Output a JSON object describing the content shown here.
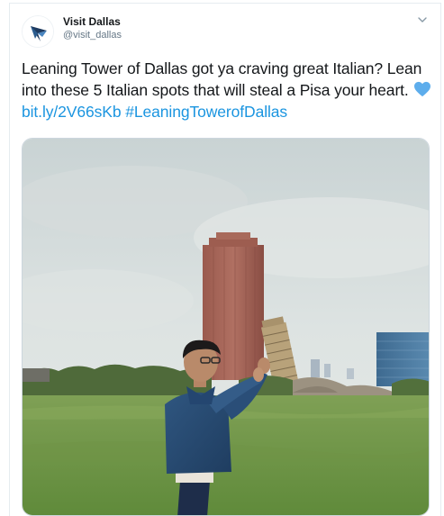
{
  "tweet": {
    "display_name": "Visit Dallas",
    "handle": "@visit_dallas",
    "text_before": "Leaning Tower of Dallas got ya craving great Italian? Lean into these 5 Italian spots that will steal a Pisa your heart.",
    "link": "bit.ly/2V66sKb",
    "hashtag": "#LeaningTowerofDallas",
    "heart_icon": "blue-heart-emoji",
    "avatar_icon": "visit-dallas-star-logo",
    "menu_icon": "chevron-down-icon"
  },
  "colors": {
    "link": "#1b95e0",
    "text": "#14171a",
    "muted": "#657786",
    "heart": "#5dadec",
    "logo_navy": "#1e3a5f"
  }
}
